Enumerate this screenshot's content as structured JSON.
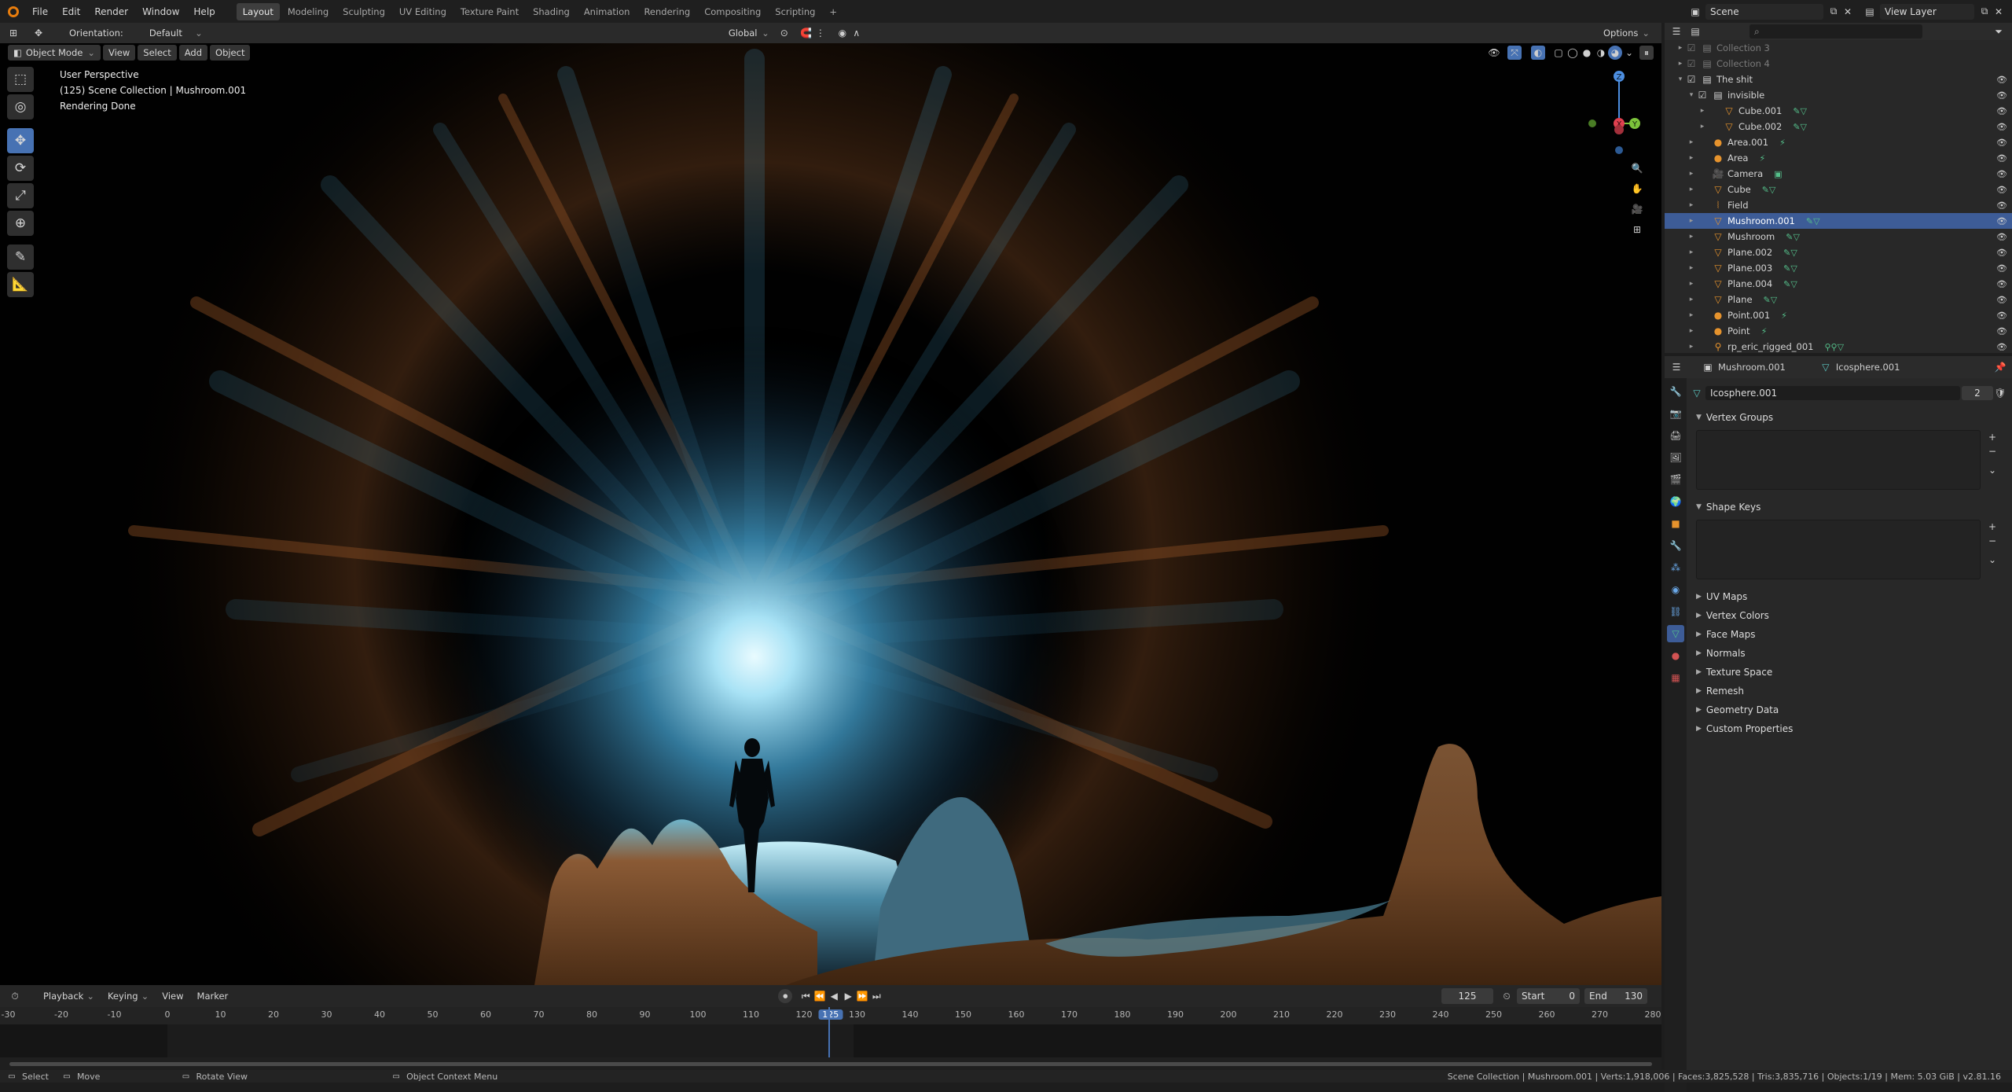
{
  "topbar": {
    "menus": [
      "File",
      "Edit",
      "Render",
      "Window",
      "Help"
    ],
    "workspaces": [
      "Layout",
      "Modeling",
      "Sculpting",
      "UV Editing",
      "Texture Paint",
      "Shading",
      "Animation",
      "Rendering",
      "Compositing",
      "Scripting"
    ],
    "active_workspace": "Layout",
    "add_tab": "+",
    "scene": "Scene",
    "view_layer": "View Layer"
  },
  "tool_header": {
    "orientation_label": "Orientation:",
    "orientation_value": "Default",
    "transform_orientation": "Global",
    "options": "Options"
  },
  "viewport_header": {
    "mode": "Object Mode",
    "menus": [
      "View",
      "Select",
      "Add",
      "Object"
    ]
  },
  "viewport": {
    "info_line1": "User Perspective",
    "info_line2": "(125) Scene Collection | Mushroom.001",
    "info_line3": "Rendering Done",
    "gizmo_axes": {
      "z": "Z",
      "x": "X",
      "y": "Y"
    },
    "colors": {
      "x": "#e0404f",
      "y": "#7cc33b",
      "z": "#4c8ee0"
    }
  },
  "timeline": {
    "menus": [
      "Playback",
      "Keying",
      "View",
      "Marker"
    ],
    "current_frame": "125",
    "start_label": "Start",
    "start": "0",
    "end_label": "End",
    "end": "130",
    "ticks": [
      "-30",
      "-20",
      "-10",
      "0",
      "10",
      "20",
      "30",
      "40",
      "50",
      "60",
      "70",
      "80",
      "90",
      "100",
      "110",
      "120",
      "125",
      "130",
      "140",
      "150",
      "160",
      "170",
      "180",
      "190",
      "200",
      "210",
      "220",
      "230",
      "240",
      "250",
      "260",
      "270",
      "280"
    ]
  },
  "statusbar": {
    "select": "Select",
    "move": "Move",
    "rotate": "Rotate View",
    "context": "Object Context Menu",
    "stats": "Scene Collection | Mushroom.001 | Verts:1,918,006 | Faces:3,825,528 | Tris:3,835,716 | Objects:1/19 | Mem: 5.03 GiB | v2.81.16"
  },
  "outliner": {
    "rows": [
      {
        "name": "Collection 3",
        "indent": 1,
        "icon": "collection",
        "dim": true
      },
      {
        "name": "Collection 4",
        "indent": 1,
        "icon": "collection",
        "dim": true
      },
      {
        "name": "The shit",
        "indent": 1,
        "icon": "collection",
        "open": true
      },
      {
        "name": "invisible",
        "indent": 2,
        "icon": "collection",
        "open": true
      },
      {
        "name": "Cube.001",
        "indent": 3,
        "icon": "mesh"
      },
      {
        "name": "Cube.002",
        "indent": 3,
        "icon": "mesh"
      },
      {
        "name": "Area.001",
        "indent": 2,
        "icon": "light"
      },
      {
        "name": "Area",
        "indent": 2,
        "icon": "light"
      },
      {
        "name": "Camera",
        "indent": 2,
        "icon": "camera"
      },
      {
        "name": "Cube",
        "indent": 2,
        "icon": "mesh"
      },
      {
        "name": "Field",
        "indent": 2,
        "icon": "field"
      },
      {
        "name": "Mushroom.001",
        "indent": 2,
        "icon": "mesh",
        "selected": true
      },
      {
        "name": "Mushroom",
        "indent": 2,
        "icon": "mesh"
      },
      {
        "name": "Plane.002",
        "indent": 2,
        "icon": "mesh"
      },
      {
        "name": "Plane.003",
        "indent": 2,
        "icon": "mesh"
      },
      {
        "name": "Plane.004",
        "indent": 2,
        "icon": "mesh"
      },
      {
        "name": "Plane",
        "indent": 2,
        "icon": "mesh"
      },
      {
        "name": "Point.001",
        "indent": 2,
        "icon": "light"
      },
      {
        "name": "Point",
        "indent": 2,
        "icon": "light"
      },
      {
        "name": "rp_eric_rigged_001",
        "indent": 2,
        "icon": "armature"
      }
    ]
  },
  "properties": {
    "object": "Mushroom.001",
    "data": "Icosphere.001",
    "mesh_name": "Icosphere.001",
    "users": "2",
    "panels_open": [
      "Vertex Groups",
      "Shape Keys"
    ],
    "panels_closed": [
      "UV Maps",
      "Vertex Colors",
      "Face Maps",
      "Normals",
      "Texture Space",
      "Remesh",
      "Geometry Data",
      "Custom Properties"
    ]
  }
}
